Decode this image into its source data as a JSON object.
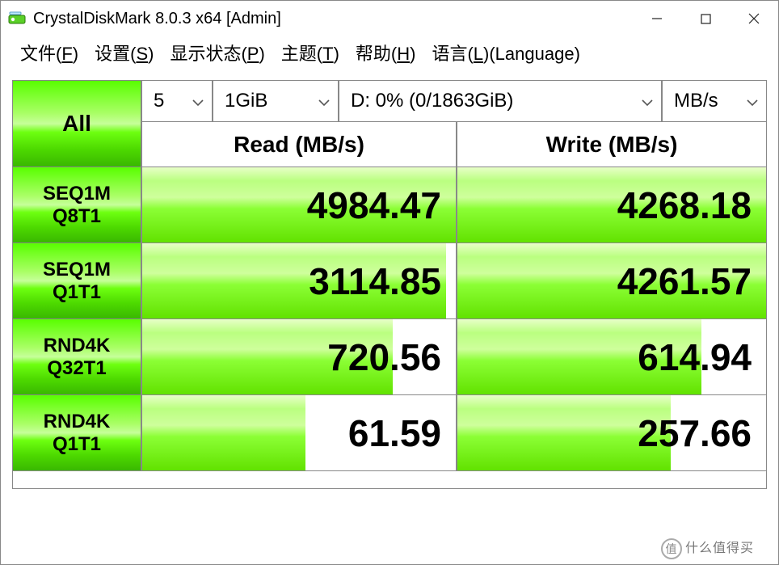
{
  "window": {
    "title": "CrystalDiskMark 8.0.3 x64 [Admin]"
  },
  "menu": {
    "file": "文件(",
    "file_u": "F",
    "file_end": ")",
    "settings": "设置(",
    "settings_u": "S",
    "settings_end": ")",
    "display": "显示状态(",
    "display_u": "P",
    "display_end": ")",
    "theme": "主题(",
    "theme_u": "T",
    "theme_end": ")",
    "help": "帮助(",
    "help_u": "H",
    "help_end": ")",
    "language": "语言(",
    "language_u": "L",
    "language_end": ")(Language)"
  },
  "controls": {
    "all": "All",
    "count": "5",
    "size": "1GiB",
    "drive": "D: 0% (0/1863GiB)",
    "unit": "MB/s"
  },
  "headers": {
    "read": "Read (MB/s)",
    "write": "Write (MB/s)"
  },
  "tests": [
    {
      "line1": "SEQ1M",
      "line2": "Q8T1",
      "read": "4984.47",
      "readFill": 100,
      "write": "4268.18",
      "writeFill": 100
    },
    {
      "line1": "SEQ1M",
      "line2": "Q1T1",
      "read": "3114.85",
      "readFill": 97,
      "write": "4261.57",
      "writeFill": 100
    },
    {
      "line1": "RND4K",
      "line2": "Q32T1",
      "read": "720.56",
      "readFill": 80,
      "write": "614.94",
      "writeFill": 79
    },
    {
      "line1": "RND4K",
      "line2": "Q1T1",
      "read": "61.59",
      "readFill": 52,
      "write": "257.66",
      "writeFill": 69
    }
  ],
  "watermark": "什么值得买"
}
